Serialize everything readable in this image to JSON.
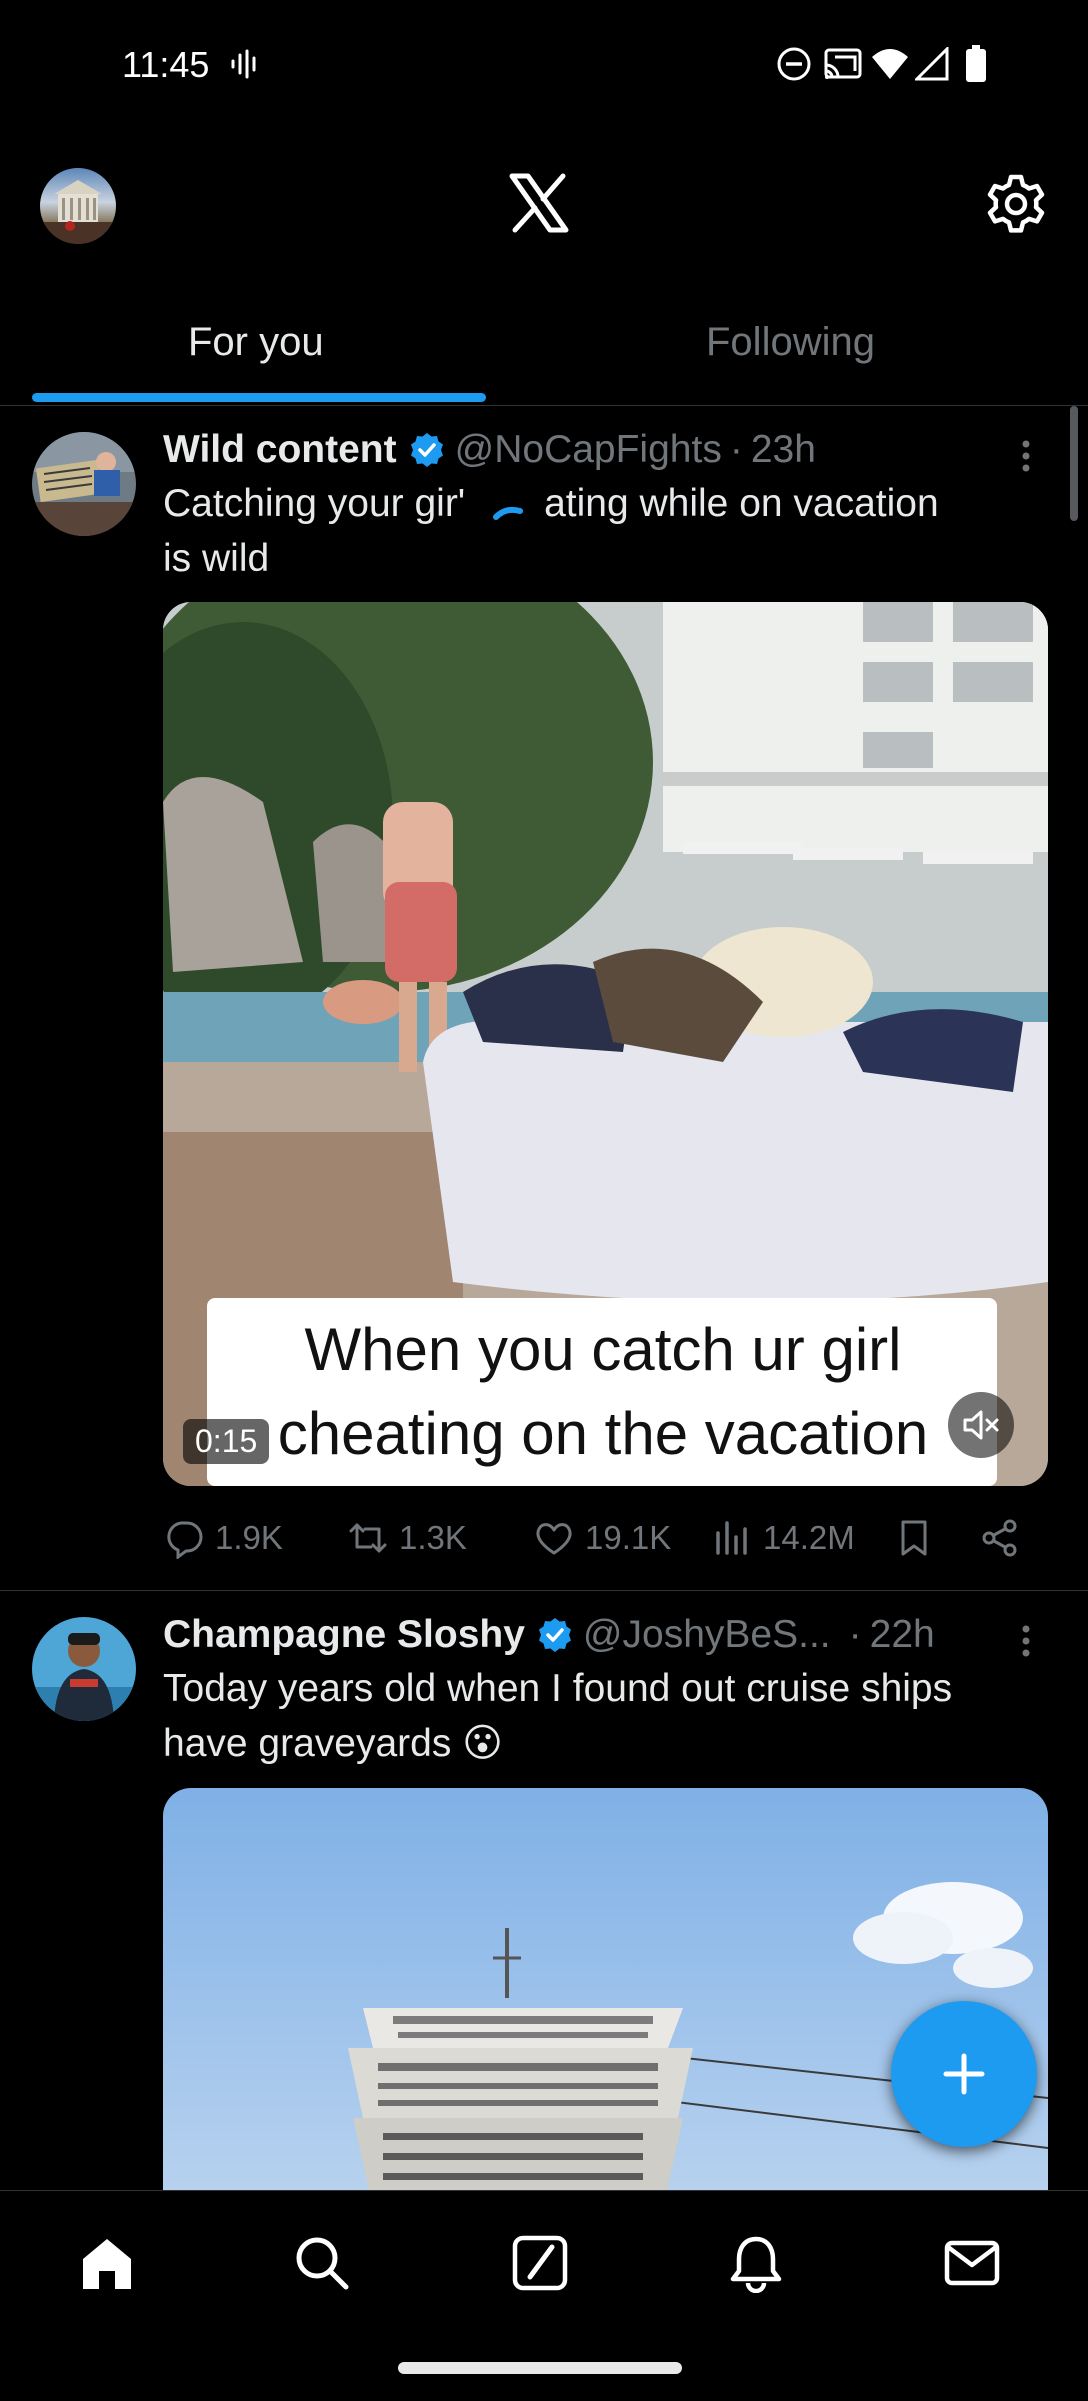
{
  "status_bar": {
    "time": "11:45",
    "icons": [
      "voice-activity-icon",
      "do-not-disturb-icon",
      "cast-icon",
      "wifi-icon",
      "cell-signal-icon",
      "battery-icon"
    ]
  },
  "header": {
    "logo": "x-logo-icon",
    "settings_icon": "gear-icon"
  },
  "tabs": [
    {
      "label": "For you",
      "active": true
    },
    {
      "label": "Following",
      "active": false
    }
  ],
  "accent_color": "#1d9bf0",
  "tweets": [
    {
      "name": "Wild content",
      "verified": true,
      "handle": "@NoCapFights",
      "separator": "·",
      "age": "23h",
      "text_line1_a": "Catching your gir'",
      "text_line1_b": "ating while on vacation",
      "text_line2": "is wild",
      "media": {
        "type": "video",
        "caption_line1": "When you catch ur girl",
        "caption_line2": "cheating on the vacation",
        "duration": "0:15",
        "muted": true
      },
      "stats": {
        "replies": "1.9K",
        "reposts": "1.3K",
        "likes": "19.1K",
        "views": "14.2M"
      }
    },
    {
      "name": "Champagne Sloshy",
      "verified": true,
      "handle": "@JoshyBeS...",
      "separator": "·",
      "age": "22h",
      "text_line1": "Today years old when I found out cruise ships",
      "text_line2": "have graveyards 😮",
      "media": {
        "type": "image"
      }
    }
  ],
  "fab": {
    "icon": "plus-icon"
  },
  "bottom_nav": [
    "home-icon",
    "search-icon",
    "grok-icon",
    "bell-icon",
    "mail-icon"
  ]
}
